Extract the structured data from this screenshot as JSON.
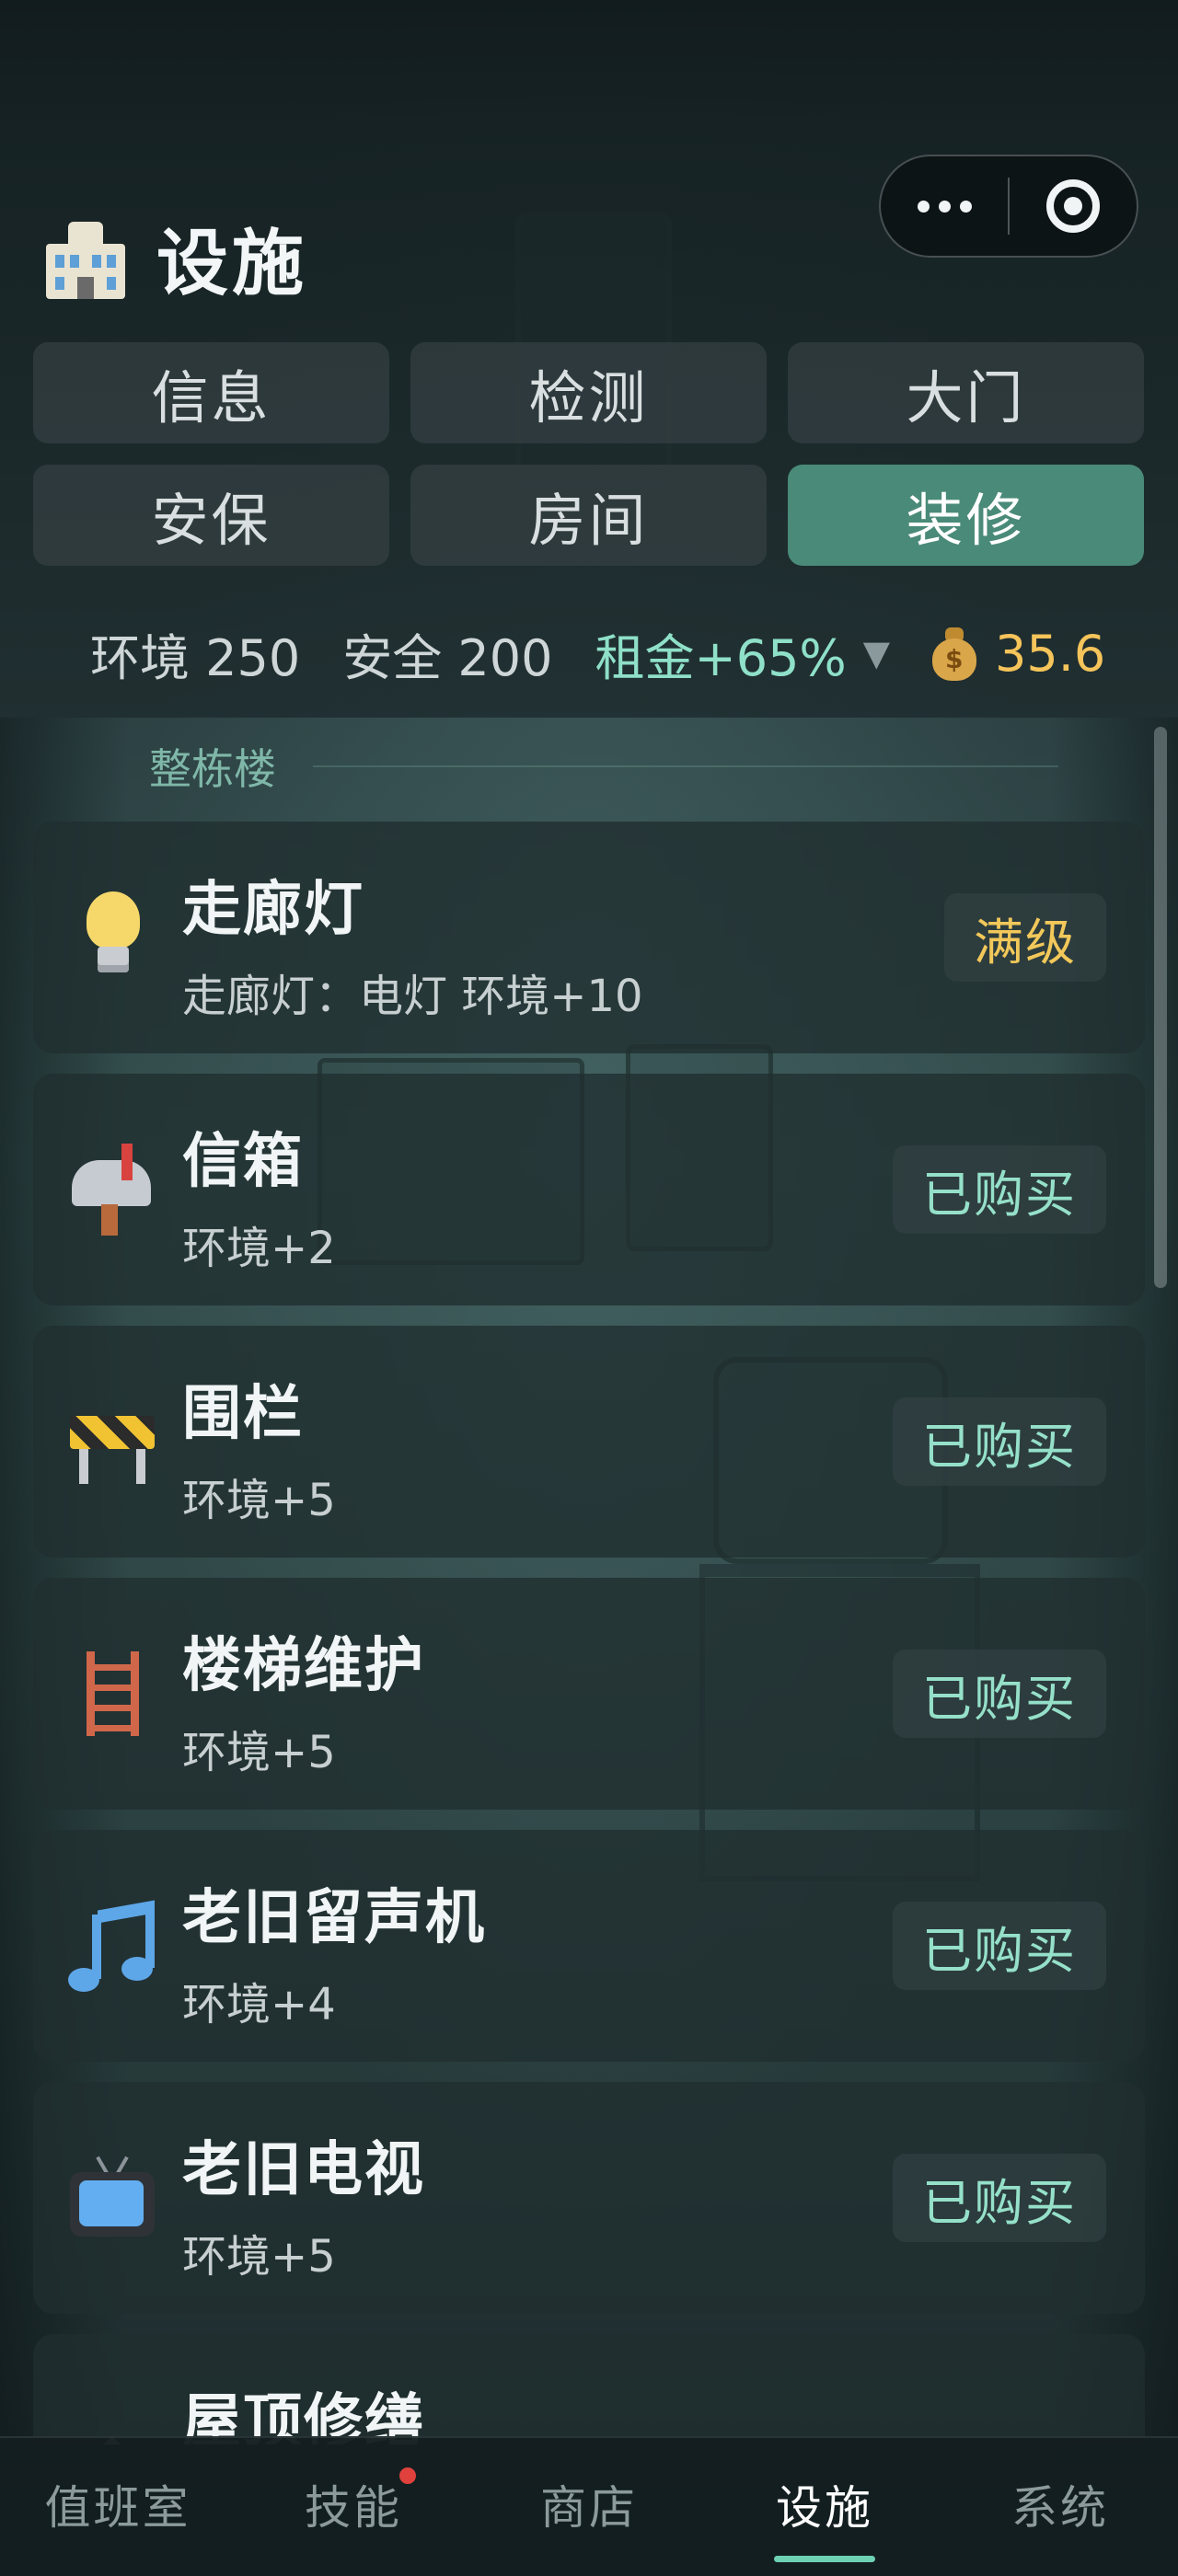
{
  "header": {
    "title": "设施",
    "title_icon": "office-building-icon",
    "capsule": {
      "more_icon": "more-dots-icon",
      "close_icon": "target-circle-icon"
    }
  },
  "tabs": [
    {
      "label": "信息",
      "active": false
    },
    {
      "label": "检测",
      "active": false
    },
    {
      "label": "大门",
      "active": false
    },
    {
      "label": "安保",
      "active": false
    },
    {
      "label": "房间",
      "active": false
    },
    {
      "label": "装修",
      "active": true
    }
  ],
  "stats": {
    "environment": "环境 250",
    "safety": "安全 200",
    "rent": "租金+65%",
    "rent_arrow": "▼",
    "money": "35.6",
    "money_icon": "money-bag-icon"
  },
  "section": {
    "label": "整栋楼"
  },
  "items": [
    {
      "name": "走廊灯",
      "desc": "走廊灯：电灯 环境+10",
      "status": "满级",
      "icon": "light-bulb-icon"
    },
    {
      "name": "信箱",
      "desc": "环境+2",
      "status": "已购买",
      "icon": "mailbox-icon"
    },
    {
      "name": "围栏",
      "desc": "环境+5",
      "status": "已购买",
      "icon": "construction-barrier-icon"
    },
    {
      "name": "楼梯维护",
      "desc": "环境+5",
      "status": "已购买",
      "icon": "ladder-icon"
    },
    {
      "name": "老旧留声机",
      "desc": "环境+4",
      "status": "已购买",
      "icon": "music-note-icon"
    },
    {
      "name": "老旧电视",
      "desc": "环境+5",
      "status": "已购买",
      "icon": "television-icon"
    },
    {
      "name": "屋顶修缮",
      "icon": "house-roof-icon"
    }
  ],
  "nav": [
    {
      "label": "值班室",
      "active": false
    },
    {
      "label": "技能",
      "active": false,
      "badge": true
    },
    {
      "label": "商店",
      "active": false
    },
    {
      "label": "设施",
      "active": true
    },
    {
      "label": "系统",
      "active": false
    }
  ],
  "colors": {
    "accent": "#4a8a78",
    "rent_green": "#8fe0c8",
    "money_gold": "#f5c45a",
    "max_level_gold": "#f2c85a",
    "badge_red": "#e0413c"
  }
}
